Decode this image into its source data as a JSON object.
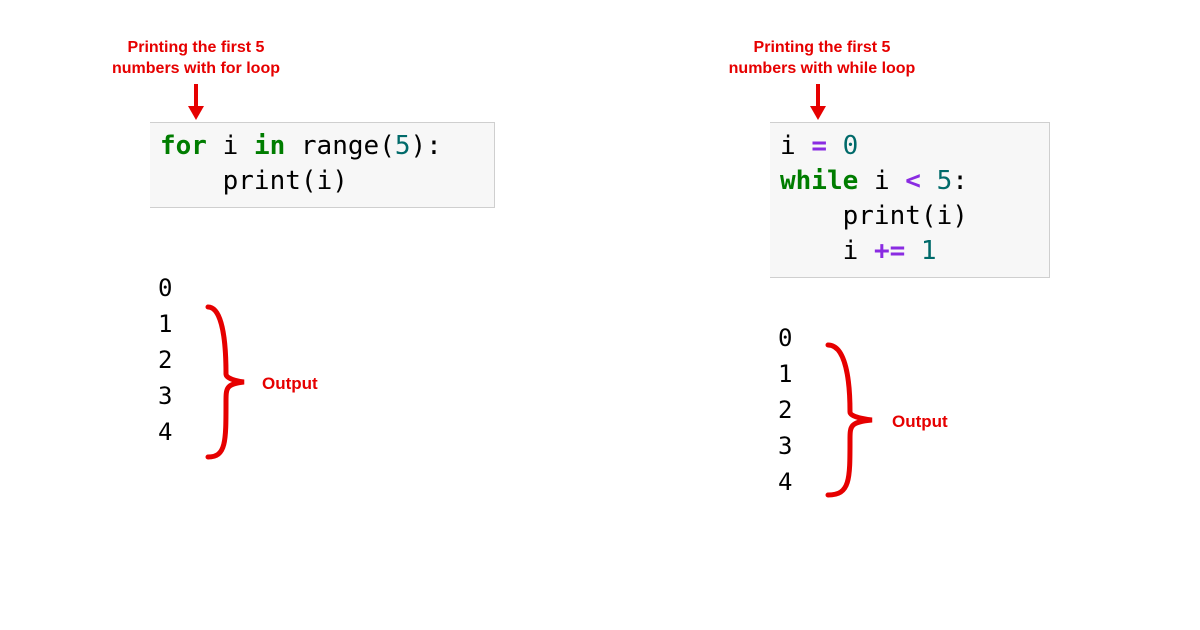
{
  "left": {
    "annotation": "Printing the first 5\nnumbers with for loop",
    "code_tokens": {
      "for": "for",
      "var": "i",
      "in": "in",
      "range": "range",
      "lp": "(",
      "five": "5",
      "rp": ")",
      "colon": ":",
      "indent": "    ",
      "print": "print",
      "lp2": "(",
      "arg": "i",
      "rp2": ")"
    },
    "output": [
      "0",
      "1",
      "2",
      "3",
      "4"
    ],
    "output_label": "Output"
  },
  "right": {
    "annotation": "Printing the first 5\nnumbers with while loop",
    "code_tokens": {
      "var": "i",
      "assign": "=",
      "zero": "0",
      "while": "while",
      "var2": "i",
      "lt": "<",
      "five": "5",
      "colon": ":",
      "indent": "    ",
      "print": "print",
      "lp": "(",
      "arg": "i",
      "rp": ")",
      "var3": "i",
      "pluseq": "+=",
      "one": "1"
    },
    "output": [
      "0",
      "1",
      "2",
      "3",
      "4"
    ],
    "output_label": "Output"
  },
  "colors": {
    "red": "#e60000"
  }
}
